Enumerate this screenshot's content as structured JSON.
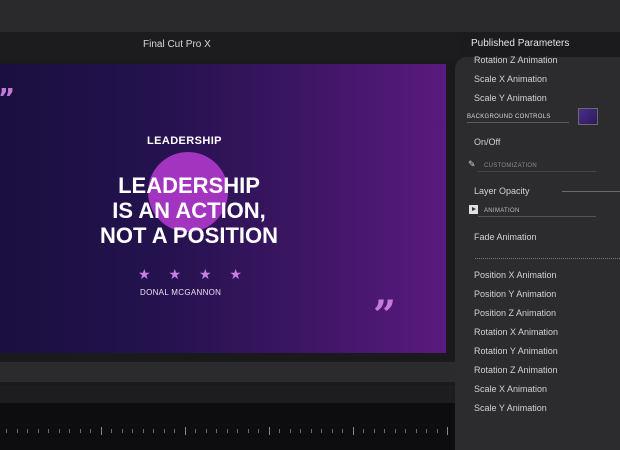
{
  "app": {
    "title": "Final Cut Pro X"
  },
  "viewer": {
    "headline": "LEADERSHIP",
    "quote_lines": [
      "LEADERSHIP",
      "IS AN ACTION,",
      "NOT A POSITION"
    ],
    "stars": [
      "★",
      "★",
      "★",
      "★"
    ],
    "author": "DONAL MCGANNON",
    "open_quote": "”",
    "close_quote": "”"
  },
  "panel": {
    "title": "Published Parameters",
    "top_items": [
      "Rotation Z Animation",
      "Scale X Animation",
      "Scale Y Animation"
    ],
    "background_controls_label": "BACKGROUND CONTROLS",
    "on_off_label": "On/Off",
    "customization_label": "CUSTOMIZATION",
    "layer_opacity_label": "Layer Opacity",
    "animation_label": "ANIMATION",
    "fade_animation_label": "Fade Animation",
    "animation_items": [
      "Position X Animation",
      "Position Y Animation",
      "Position Z Animation",
      "Rotation X Animation",
      "Rotation Y Animation",
      "Rotation Z Animation",
      "Scale X Animation",
      "Scale Y Animation"
    ]
  },
  "icons": {
    "background": "image-thumbnail-icon",
    "customization": "pencil-icon",
    "animation": "play-icon"
  },
  "colors": {
    "accent": "#a234c0",
    "star": "#c87ee2"
  }
}
